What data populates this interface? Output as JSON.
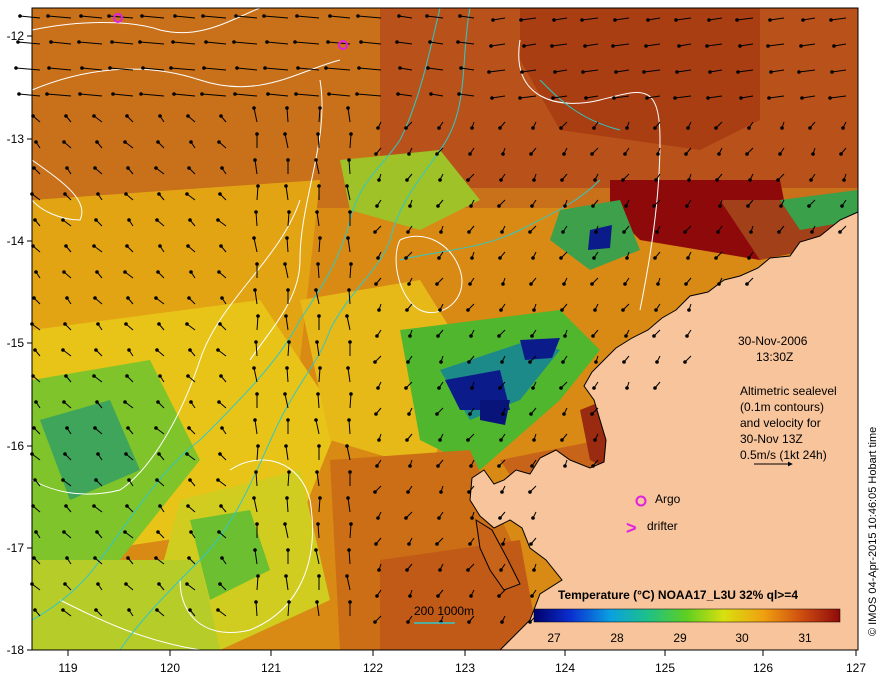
{
  "colors": {
    "sst_warm": "#c96a10",
    "sst_hot": "#8e0a0a",
    "sst_mid": "#e8b812",
    "sst_green": "#5fbf2a",
    "sst_cool": "#2b9a7a",
    "sst_cold": "#0b1c8a",
    "land": "#f7c49b",
    "contour": "#ffffff",
    "isobath": "#30c8c8",
    "argo": "#e020e0",
    "drifter": "#e020e0"
  },
  "axes": {
    "x_ticks": [
      "119",
      "120",
      "121",
      "122",
      "123",
      "124",
      "125",
      "126",
      "127"
    ],
    "y_ticks": [
      "-12",
      "-13",
      "-14",
      "-15",
      "-16",
      "-17",
      "-18"
    ]
  },
  "annotation": {
    "date": "30-Nov-2006",
    "time": "13:30Z",
    "desc_line1": "Altimetric sealevel",
    "desc_line2": "(0.1m contours)",
    "desc_line3": "and velocity for",
    "desc_line4": "30-Nov 13Z",
    "desc_line5": "0.5m/s (1kt 24h)"
  },
  "legend": {
    "argo": "Argo",
    "drifter": "drifter",
    "drifter_symbol": ">"
  },
  "isobath_label": "200  1000m",
  "colorbar": {
    "title": "Temperature (°C) NOAA17_L3U 32% ql>=4",
    "ticks": [
      "27",
      "28",
      "29",
      "30",
      "31"
    ]
  },
  "credit": "© IMOS 04-Apr-2015 10:46:05 Hobart time"
}
